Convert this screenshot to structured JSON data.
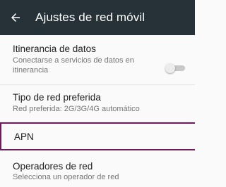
{
  "appbar": {
    "title": "Ajustes de red móvil",
    "back_icon": "arrow-left-icon",
    "background": "#263238"
  },
  "settings": [
    {
      "title": "Itinerancia de datos",
      "summary": "Conectarse a servicios de datos en itinerancia",
      "toggle_on": false
    },
    {
      "title": "Tipo de red preferida",
      "summary": "Red preferida: 2G/3G/4G automático"
    },
    {
      "title": "APN",
      "highlight_color": "#6b1a5b"
    },
    {
      "title": "Operadores de red",
      "summary": "Selecciona un operador de red"
    }
  ]
}
